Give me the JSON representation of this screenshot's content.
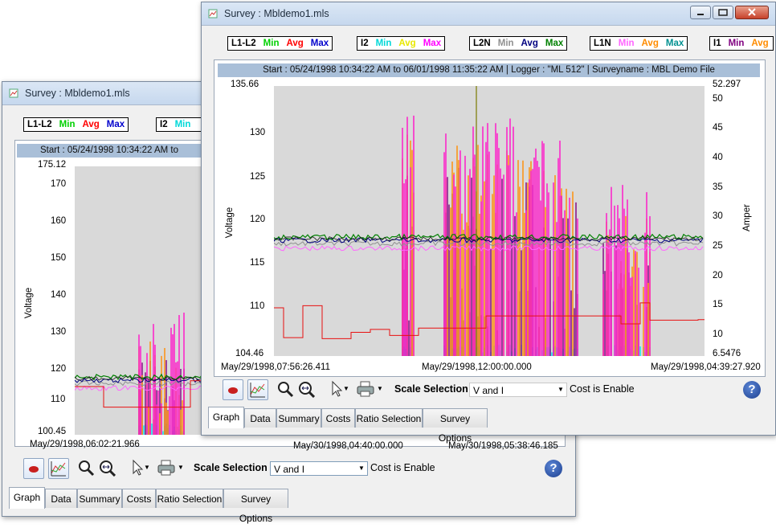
{
  "colors": {
    "l1l2": "#000000",
    "min": "#00d000",
    "avg": "#ff0000",
    "max": "#0000cc",
    "i2_min": "#00d8d8",
    "i2_avg": "#e8e800",
    "i2_max": "#ff00ff",
    "l2n_min": "#909090",
    "l2n_avg": "#000080",
    "l2n_max": "#008000",
    "l1n_min": "#ff66ff",
    "l1n_avg": "#ff8c00",
    "l1n_max": "#009090",
    "i1_min": "#800080",
    "plot_bg": "#d9d9d9",
    "header_band": "#a9bfd8"
  },
  "back_window": {
    "title": "Survey : Mbldemo1.mls",
    "legend": {
      "g1": {
        "name": "L1-L2",
        "min": "Min",
        "avg": "Avg",
        "max": "Max"
      },
      "g2": {
        "name": "I2",
        "min": "Min"
      }
    },
    "header": "Start : 05/24/1998  10:34:22 AM to",
    "y_left": {
      "label": "Voltage",
      "top": "175.12",
      "bottom": "100.45",
      "ticks": [
        "170",
        "160",
        "150",
        "140",
        "130",
        "120",
        "110"
      ]
    },
    "x_labels": [
      "May/29/1998,06:02:21.966",
      "May/30/1998,04:40:00.000",
      "May/30/1998,05:38:46.185"
    ],
    "toolbar": {
      "scale_label": "Scale Selection",
      "scale_value": "V and I",
      "cost_label": "Cost is Enable"
    },
    "tabs": [
      "Graph",
      "Data",
      "Summary",
      "Costs",
      "Ratio Selection",
      "Survey Options"
    ]
  },
  "front_window": {
    "title": "Survey : Mbldemo1.mls",
    "legend": {
      "g1": {
        "name": "L1-L2",
        "min": "Min",
        "avg": "Avg",
        "max": "Max"
      },
      "g2": {
        "name": "I2",
        "min": "Min",
        "avg": "Avg",
        "max": "Max"
      },
      "g3": {
        "name": "L2N",
        "min": "Min",
        "avg": "Avg",
        "max": "Max"
      },
      "g4": {
        "name": "L1N",
        "min": "Min",
        "avg": "Avg",
        "max": "Max"
      },
      "g5": {
        "name": "I1",
        "min": "Min",
        "avg": "Avg"
      }
    },
    "header": "Start : 05/24/1998  10:34:22 AM to 06/01/1998  11:35:22 AM | Logger : \"ML 512\" | Surveyname : MBL Demo File",
    "y_left": {
      "label": "Voltage",
      "top": "135.66",
      "bottom": "104.46",
      "ticks": [
        "130",
        "125",
        "120",
        "115",
        "110"
      ]
    },
    "y_right": {
      "label": "Amper",
      "top": "52.297",
      "bottom": "6.5476",
      "ticks": [
        "50",
        "45",
        "40",
        "35",
        "30",
        "25",
        "20",
        "15",
        "10"
      ]
    },
    "x_labels": [
      "May/29/1998,07:56:26.411",
      "May/29/1998,12:00:00.000",
      "May/29/1998,04:39:27.920"
    ],
    "toolbar": {
      "scale_label": "Scale Selection",
      "scale_value": "V and I",
      "cost_label": "Cost is Enable"
    },
    "tabs": [
      "Graph",
      "Data",
      "Summary",
      "Costs",
      "Ratio Selection",
      "Survey Options"
    ]
  }
}
